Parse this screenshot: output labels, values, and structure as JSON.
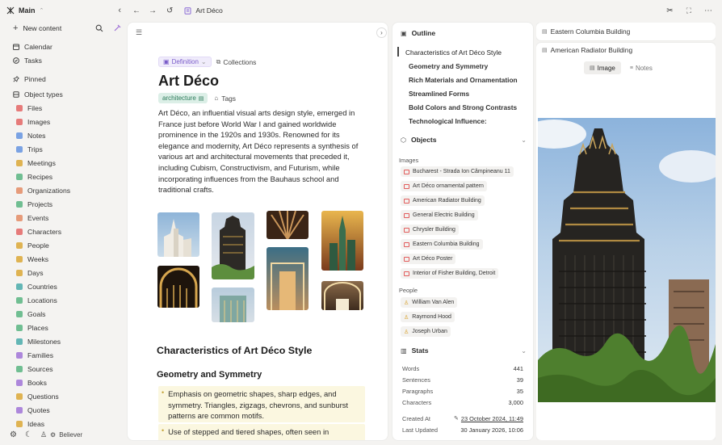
{
  "sidebar": {
    "workspace": "Main",
    "new_content": "New content",
    "primary": [
      {
        "label": "Calendar",
        "icon": "calendar-icon"
      },
      {
        "label": "Tasks",
        "icon": "check-circle-icon"
      }
    ],
    "pinned_label": "Pinned",
    "object_types_label": "Object types",
    "types": [
      {
        "label": "Files",
        "color": "#e25c5c"
      },
      {
        "label": "Images",
        "color": "#e25c5c"
      },
      {
        "label": "Notes",
        "color": "#5b8de0"
      },
      {
        "label": "Trips",
        "color": "#5b8de0"
      },
      {
        "label": "Meetings",
        "color": "#d9a22b"
      },
      {
        "label": "Recipes",
        "color": "#4fb07a"
      },
      {
        "label": "Organizations",
        "color": "#e2845c"
      },
      {
        "label": "Projects",
        "color": "#4fb07a"
      },
      {
        "label": "Events",
        "color": "#e2845c"
      },
      {
        "label": "Characters",
        "color": "#e25c5c"
      },
      {
        "label": "People",
        "color": "#d9a22b"
      },
      {
        "label": "Weeks",
        "color": "#d9a22b"
      },
      {
        "label": "Days",
        "color": "#d9a22b"
      },
      {
        "label": "Countries",
        "color": "#3fa6a6"
      },
      {
        "label": "Locations",
        "color": "#4fb07a"
      },
      {
        "label": "Goals",
        "color": "#4fb07a"
      },
      {
        "label": "Places",
        "color": "#4fb07a"
      },
      {
        "label": "Milestones",
        "color": "#3fa6a6"
      },
      {
        "label": "Families",
        "color": "#9b6bd6"
      },
      {
        "label": "Sources",
        "color": "#4fb07a"
      },
      {
        "label": "Books",
        "color": "#9b6bd6"
      },
      {
        "label": "Questions",
        "color": "#d9a22b"
      },
      {
        "label": "Quotes",
        "color": "#9b6bd6"
      },
      {
        "label": "Ideas",
        "color": "#d9a22b"
      }
    ],
    "footer_user": "Believer"
  },
  "topbar": {
    "title": "Art Déco"
  },
  "document": {
    "type_chip": "Definition",
    "collections": "Collections",
    "title": "Art Déco",
    "tag": "architecture",
    "tags_label": "Tags",
    "body": "Art Déco, an influential visual arts design style, emerged in France just before World War I and gained worldwide prominence in the 1920s and 1930s. Renowned for its elegance and modernity, Art Déco represents a synthesis of various art and architectural movements that preceded it, including Cubism, Constructivism, and Futurism, while incorporating influences from the Bauhaus school and traditional crafts.",
    "h2": "Characteristics of Art Déco Style",
    "h3": "Geometry and Symmetry",
    "bullets": [
      "Emphasis on geometric shapes, sharp edges, and symmetry. Triangles, zigzags, chevrons, and sunburst patterns are common motifs.",
      "Use of stepped and tiered shapes, often seen in"
    ]
  },
  "outline": {
    "label": "Outline",
    "items": [
      "Characteristics of Art Déco Style",
      "Geometry and Symmetry",
      "Rich Materials and Ornamentation",
      "Streamlined Forms",
      "Bold Colors and Strong Contrasts",
      "Technological Influence:"
    ],
    "objects_label": "Objects",
    "images_label": "Images",
    "images": [
      "Bucharest - Strada Ion Câmpineanu 11",
      "Art Déco ornamental pattern",
      "American Radiator Building",
      "General Electric Building",
      "Chrysler Building",
      "Eastern Columbia Building",
      "Art Déco Poster",
      "Interior of Fisher Building, Detroit"
    ],
    "people_label": "People",
    "people": [
      "William Van Alen",
      "Raymond Hood",
      "Joseph Urban"
    ],
    "stats_label": "Stats",
    "stats": [
      {
        "label": "Words",
        "value": "441"
      },
      {
        "label": "Sentences",
        "value": "39"
      },
      {
        "label": "Paragraphs",
        "value": "35"
      },
      {
        "label": "Characters",
        "value": "3,000"
      }
    ],
    "created_label": "Created At",
    "created_value": "23 October 2024, 11:49",
    "updated_label": "Last Updated",
    "updated_value": "30 January 2026, 10:06"
  },
  "right": {
    "tab1": "Eastern Columbia Building",
    "tab2": "American Radiator Building",
    "view_image": "Image",
    "view_notes": "Notes"
  }
}
